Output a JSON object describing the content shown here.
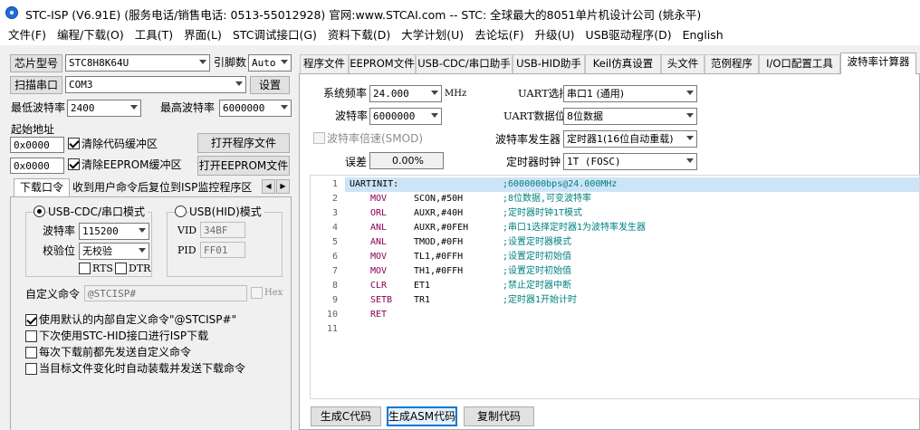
{
  "window": {
    "title": "STC-ISP (V6.91E) (服务电话/销售电话: 0513-55012928) 官网:www.STCAI.com  -- STC: 全球最大的8051单片机设计公司 (姚永平)"
  },
  "menu": [
    "文件(F)",
    "编程/下载(O)",
    "工具(T)",
    "界面(L)",
    "STC调试接口(G)",
    "资料下载(D)",
    "大学计划(U)",
    "去论坛(F)",
    "升级(U)",
    "USB驱动程序(D)",
    "English"
  ],
  "left": {
    "chip_label": "芯片型号",
    "chip_value": "STC8H8K64U",
    "pin_label": "引脚数",
    "pin_value": "Auto",
    "scan_button": "扫描串口",
    "port_value": "COM3",
    "settings_button": "设置",
    "min_baud_label": "最低波特率",
    "min_baud_value": "2400",
    "max_baud_label": "最高波特率",
    "max_baud_value": "6000000",
    "start_addr_label": "起始地址",
    "addr1": "0x0000",
    "clear_code_label": "清除代码缓冲区",
    "open_prog_button": "打开程序文件",
    "addr2": "0x0000",
    "clear_eeprom_label": "清除EEPROM缓冲区",
    "open_eeprom_button": "打开EEPROM文件",
    "sub_tabs": [
      "下载口令",
      "收到用户命令后复位到ISP监控程序区"
    ],
    "usb_cdc_label": "USB-CDC/串口模式",
    "usb_hid_label": "USB(HID)模式",
    "baud_label": "波特率",
    "baud_value": "115200",
    "parity_label": "校验位",
    "parity_value": "无校验",
    "rts_label": "RTS",
    "dtr_label": "DTR",
    "vid_label": "VID",
    "vid_value": "34BF",
    "pid_label": "PID",
    "pid_value": "FF01",
    "custom_cmd_label": "自定义命令",
    "custom_cmd_value": "@STCISP#",
    "hex_label": "Hex",
    "options": [
      "使用默认的内部自定义命令\"@STCISP#\"",
      "下次使用STC-HID接口进行ISP下载",
      "每次下载前都先发送自定义命令",
      "当目标文件变化时自动装载并发送下载命令"
    ]
  },
  "tabs": [
    "程序文件",
    "EEPROM文件",
    "USB-CDC/串口助手",
    "USB-HID助手",
    "Keil仿真设置",
    "头文件",
    "范例程序",
    "I/O口配置工具",
    "波特率计算器"
  ],
  "calc": {
    "sysfreq_label": "系统频率",
    "sysfreq_value": "24.000",
    "mhz_label": "MHz",
    "uart_sel_label": "UART选择",
    "uart_sel_value": "串口1 (通用)",
    "baud_label": "波特率",
    "baud_value": "6000000",
    "uart_bits_label": "UART数据位",
    "uart_bits_value": "8位数据",
    "smod_label": "波特率倍速(SMOD)",
    "gen_label": "波特率发生器",
    "gen_value": "定时器1(16位自动重载)",
    "error_label": "误差",
    "error_value": "0.00%",
    "clock_label": "定时器时钟",
    "clock_value": "1T  (FOSC)",
    "buttons": [
      "生成C代码",
      "生成ASM代码",
      "复制代码"
    ]
  },
  "code": [
    {
      "ln": "1",
      "label": "UARTINIT:",
      "op": "",
      "args": "",
      "comment": ";6000000bps@24.000MHz"
    },
    {
      "ln": "2",
      "label": "",
      "op": "MOV",
      "args": "SCON,#50H",
      "comment": ";8位数据,可变波特率"
    },
    {
      "ln": "3",
      "label": "",
      "op": "ORL",
      "args": "AUXR,#40H",
      "comment": ";定时器时钟1T模式"
    },
    {
      "ln": "4",
      "label": "",
      "op": "ANL",
      "args": "AUXR,#0FEH",
      "comment": ";串口1选择定时器1为波特率发生器"
    },
    {
      "ln": "5",
      "label": "",
      "op": "ANL",
      "args": "TMOD,#0FH",
      "comment": ";设置定时器模式"
    },
    {
      "ln": "6",
      "label": "",
      "op": "MOV",
      "args": "TL1,#0FFH",
      "comment": ";设置定时初始值"
    },
    {
      "ln": "7",
      "label": "",
      "op": "MOV",
      "args": "TH1,#0FFH",
      "comment": ";设置定时初始值"
    },
    {
      "ln": "8",
      "label": "",
      "op": "CLR",
      "args": "ET1",
      "comment": ";禁止定时器中断"
    },
    {
      "ln": "9",
      "label": "",
      "op": "SETB",
      "args": "TR1",
      "comment": ";定时器1开始计时"
    },
    {
      "ln": "10",
      "label": "",
      "op": "RET",
      "args": "",
      "comment": ""
    },
    {
      "ln": "11",
      "label": "",
      "op": "",
      "args": "",
      "comment": ""
    }
  ]
}
